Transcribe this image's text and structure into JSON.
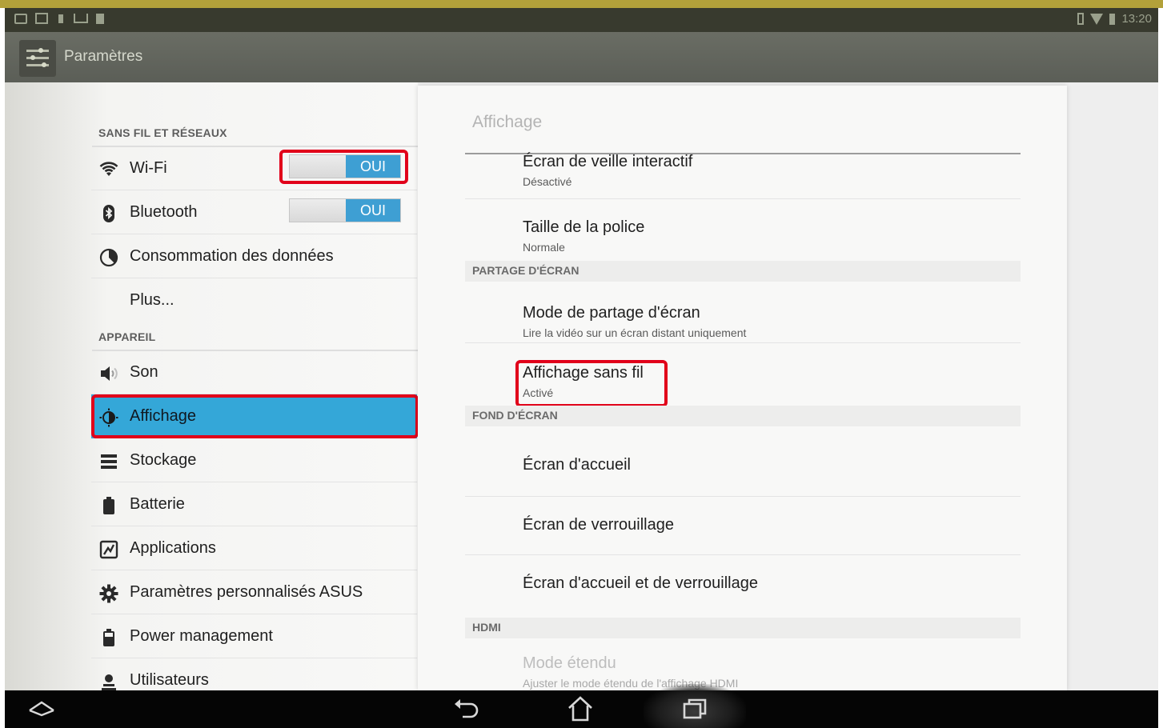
{
  "status_bar": {
    "time": "13:20",
    "icons": [
      "mail-icon",
      "image-icon",
      "lock-icon",
      "usb-icon",
      "file-icon",
      "battery-outline-icon",
      "wifi-signal-icon",
      "battery-icon"
    ]
  },
  "action_bar": {
    "title": "Paramètres",
    "icon": "settings-sliders-icon"
  },
  "left_menu": {
    "section_wireless": "SANS FIL ET RÉSEAUX",
    "wifi": {
      "label": "Wi-Fi",
      "toggle": "OUI",
      "icon": "wifi-icon"
    },
    "bluetooth": {
      "label": "Bluetooth",
      "toggle": "OUI",
      "icon": "bluetooth-icon"
    },
    "data_usage": {
      "label": "Consommation des données",
      "icon": "data-usage-icon"
    },
    "more": {
      "label": "Plus..."
    },
    "section_device": "APPAREIL",
    "items": [
      {
        "label": "Son",
        "icon": "sound-icon"
      },
      {
        "label": "Affichage",
        "icon": "display-icon",
        "selected": true
      },
      {
        "label": "Stockage",
        "icon": "storage-icon"
      },
      {
        "label": "Batterie",
        "icon": "battery-icon"
      },
      {
        "label": "Applications",
        "icon": "applications-icon"
      },
      {
        "label": "Paramètres personnalisés ASUS",
        "icon": "gear-icon"
      },
      {
        "label": "Power management",
        "icon": "power-management-icon"
      },
      {
        "label": "Utilisateurs",
        "icon": "user-icon"
      }
    ]
  },
  "detail": {
    "header": "Affichage",
    "items": {
      "daydream": {
        "title": "Écran de veille interactif",
        "summary": "Désactivé"
      },
      "font_size": {
        "title": "Taille de la police",
        "summary": "Normale"
      },
      "screen_share_mode": {
        "title": "Mode de partage d'écran",
        "summary": "Lire la vidéo sur un écran distant uniquement"
      },
      "wireless_display": {
        "title": "Affichage sans fil",
        "summary": "Activé"
      },
      "home_screen": {
        "title": "Écran d'accueil"
      },
      "lock_screen": {
        "title": "Écran de verrouillage"
      },
      "home_and_lock": {
        "title": "Écran d'accueil et de verrouillage"
      },
      "extended_mode": {
        "title": "Mode étendu",
        "summary": "Ajuster le mode étendu de l'affichage HDMI",
        "disabled": true
      }
    },
    "sections": {
      "screen_share": "PARTAGE D'ÉCRAN",
      "wallpaper": "FOND D'ÉCRAN",
      "hdmi": "HDMI"
    }
  },
  "nav_bar": {
    "buttons": [
      "asus-menu-icon",
      "back-icon",
      "home-icon",
      "recent-apps-icon"
    ]
  },
  "colors": {
    "selected_row": "#34a7d8",
    "toggle_on": "#3e9fd3",
    "highlight_box": "#e1001a",
    "status_bar": "#383a2e",
    "action_bar": "#5f625a"
  }
}
